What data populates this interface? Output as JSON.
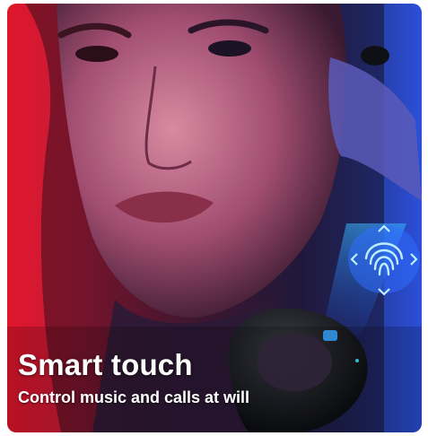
{
  "product_image": {
    "headline": "Smart touch",
    "subline": "Control music and calls at will",
    "icons": [
      "fingerprint-icon",
      "chevron-up-icon",
      "chevron-down-icon",
      "chevron-left-icon",
      "chevron-right-icon"
    ],
    "colors": {
      "red_light": "#e0162a",
      "blue_light": "#2a4fd8",
      "touch_glow": "#5ad2ff",
      "earbud": "#111318",
      "text": "#ffffff"
    }
  }
}
